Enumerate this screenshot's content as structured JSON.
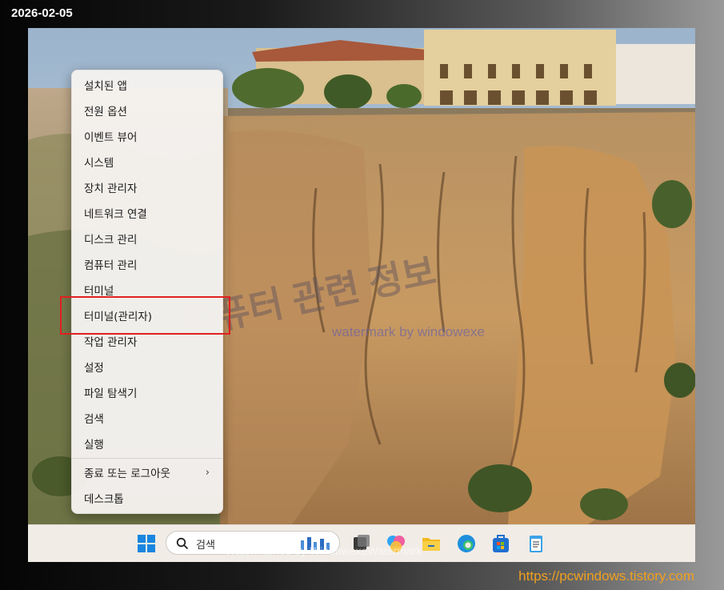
{
  "date": "2026-02-05",
  "site_url": "https://pcwindows.tistory.com",
  "context_menu": {
    "items": [
      {
        "label": "설치된 앱"
      },
      {
        "label": "전원 옵션"
      },
      {
        "label": "이벤트 뷰어"
      },
      {
        "label": "시스템"
      },
      {
        "label": "장치 관리자"
      },
      {
        "label": "네트워크 연결"
      },
      {
        "label": "디스크 관리"
      },
      {
        "label": "컴퓨터 관리"
      },
      {
        "label": "터미널"
      },
      {
        "label": "터미널(관리자)"
      },
      {
        "label": "작업 관리자"
      },
      {
        "label": "설정"
      },
      {
        "label": "파일 탐색기"
      },
      {
        "label": "검색"
      },
      {
        "label": "실행"
      },
      {
        "label": "종료 또는 로그아웃",
        "arrow": "›"
      },
      {
        "label": "데스크톱"
      }
    ],
    "highlighted_item": "터미널(관리자)",
    "highlight_color": "#e02020"
  },
  "taskbar": {
    "search_placeholder": "검색",
    "icons": [
      "windows-start-icon",
      "search-icon",
      "task-view-icon",
      "copilot-icon",
      "file-explorer-icon",
      "edge-icon",
      "microsoft-store-icon",
      "notepad-icon"
    ]
  },
  "watermarks": {
    "center_small": "watermark by windowexe",
    "center_large": "컴퓨터 관련 정보",
    "taskbar": "Watermarked by WindowexeWatermark"
  },
  "colors": {
    "url": "#f0a020",
    "menu_bg": "#f6f3f0",
    "taskbar_bg": "#f1ece6"
  }
}
